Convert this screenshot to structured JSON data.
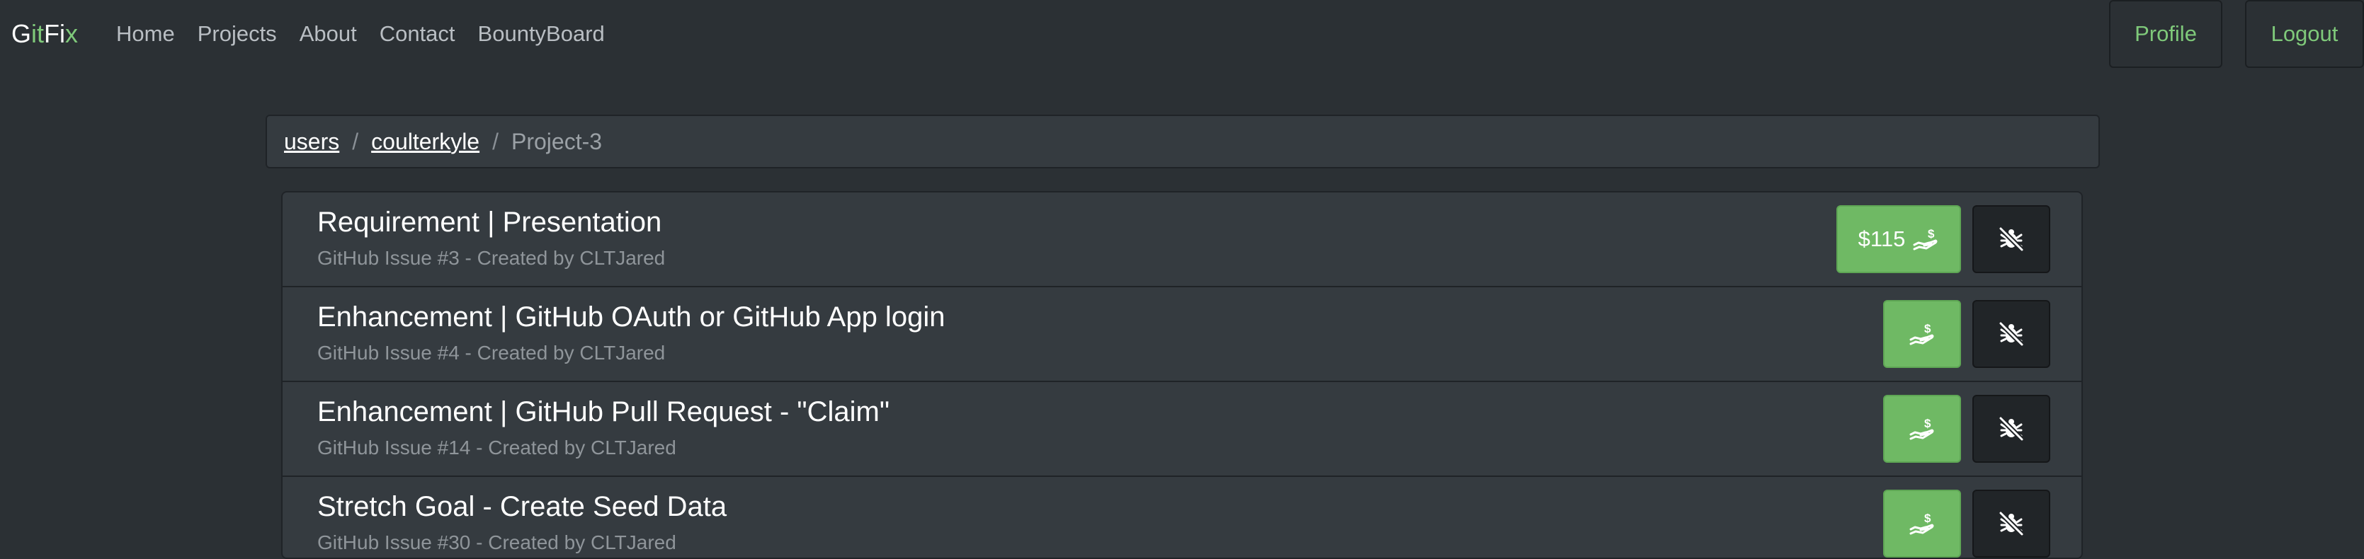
{
  "navbar": {
    "brand_part1": "G",
    "brand_part2": "it",
    "brand_part3": "Fi",
    "brand_part4": "x",
    "links": [
      "Home",
      "Projects",
      "About",
      "Contact",
      "BountyBoard"
    ],
    "profile_label": "Profile",
    "logout_label": "Logout"
  },
  "breadcrumb": {
    "items": [
      "users",
      "coulterkyle"
    ],
    "separator": "/",
    "current": "Project-3"
  },
  "issues": [
    {
      "title": "Requirement | Presentation",
      "subtitle": "GitHub Issue #3 - Created by CLTJared",
      "bounty": "$115"
    },
    {
      "title": "Enhancement | GitHub OAuth or GitHub App login",
      "subtitle": "GitHub Issue #4 - Created by CLTJared",
      "bounty": ""
    },
    {
      "title": "Enhancement | GitHub Pull Request - \"Claim\"",
      "subtitle": "GitHub Issue #14 - Created by CLTJared",
      "bounty": ""
    },
    {
      "title": "Stretch Goal - Create Seed Data",
      "subtitle": "GitHub Issue #30 - Created by CLTJared",
      "bounty": ""
    }
  ],
  "icons": {
    "bounty": "hand-coin-icon",
    "unclaim": "bug-off-icon"
  },
  "colors": {
    "accent": "#7fc97a",
    "bounty_button": "#6fb964",
    "background": "#2b3034"
  }
}
